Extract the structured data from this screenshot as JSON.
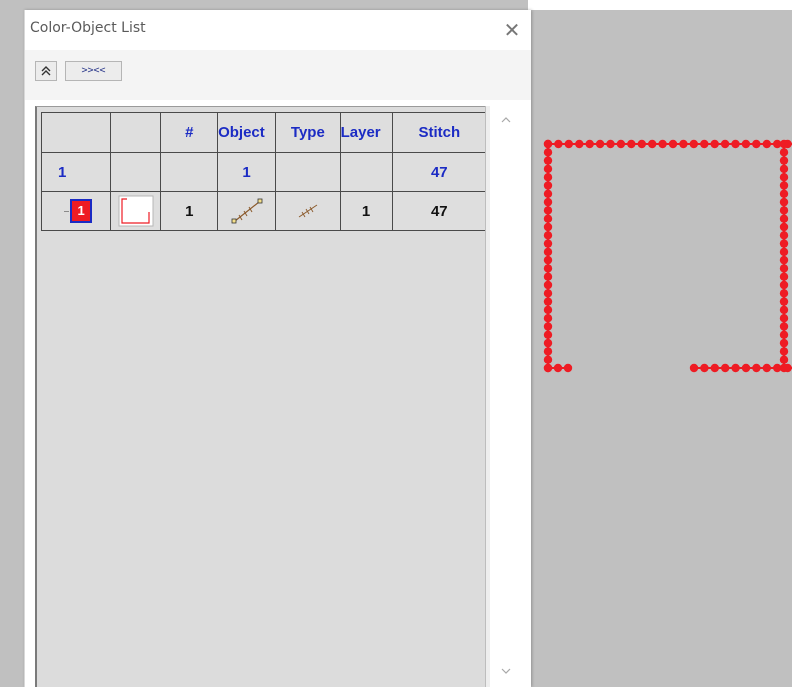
{
  "dialog": {
    "title": "Color-Object List",
    "close_symbol": "✕"
  },
  "toolbar": {
    "collapse_label": "≈",
    "collapse_icon": "double-chevron-up-icon",
    "expand_label": ">><<"
  },
  "grid": {
    "headers": [
      "",
      "",
      "#",
      "Object",
      "Type",
      "Layer",
      "Stitch"
    ],
    "summary_row": {
      "color_number": "1",
      "object_number": "1",
      "stitch": "47"
    },
    "object_row": {
      "color_chip": "1",
      "color_swatch_icon": "bracket-outline-icon",
      "number": "1",
      "object_icon": "running-stitch-line-icon",
      "type_icon": "stitch-type-icon",
      "layer": "1",
      "stitch": "47"
    }
  },
  "scrollbar": {
    "up_symbol": "^",
    "down_symbol": "v"
  },
  "colors": {
    "header_text": "#1b2bc4",
    "stitch_red": "#ee1c24",
    "grid_bg": "#dedede",
    "canvas_bg": "#c0c0c0"
  }
}
